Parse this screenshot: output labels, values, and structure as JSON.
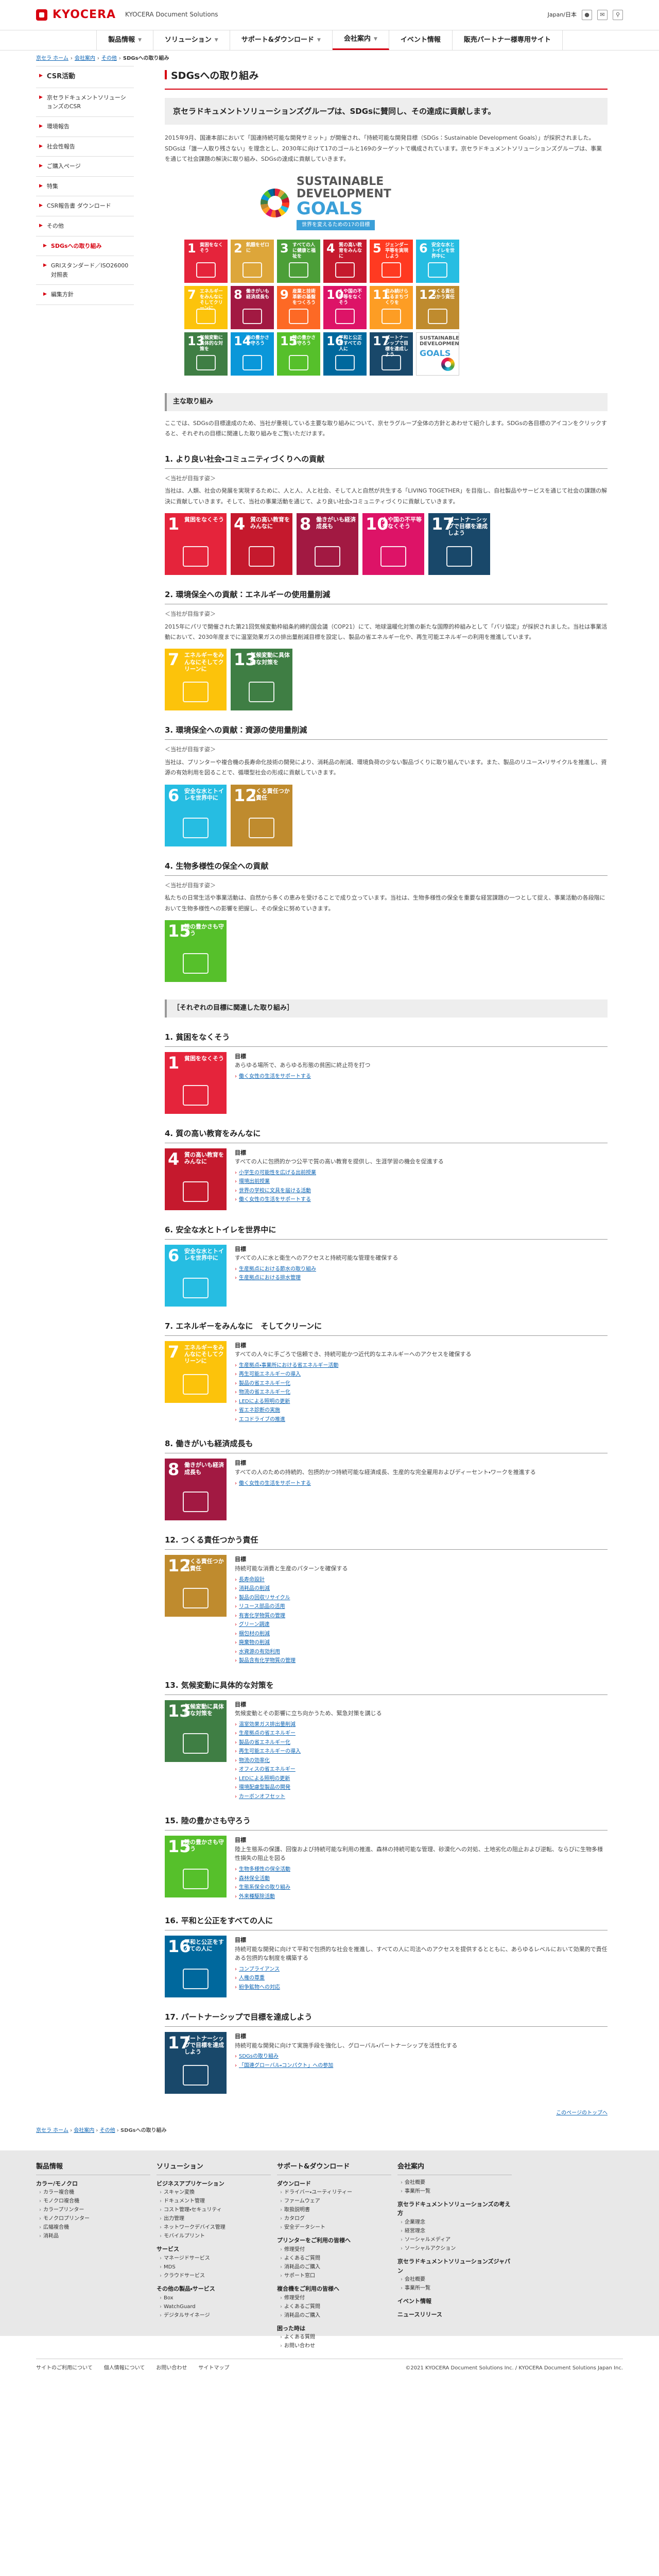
{
  "header": {
    "logo_text": "KYOCERA",
    "logo_sub": "KYOCERA Document Solutions",
    "lang": "Japan/日本",
    "nav": [
      {
        "label": "製品情報"
      },
      {
        "label": "ソリューション"
      },
      {
        "label": "サポート&ダウンロード"
      },
      {
        "label": "会社案内"
      },
      {
        "label": "イベント情報"
      },
      {
        "label": "販売パートナー様専用サイト"
      }
    ]
  },
  "breadcrumb": {
    "items": [
      "京セラ ホーム",
      "会社案内",
      "その他"
    ],
    "current": "SDGsへの取り組み"
  },
  "sidebar": {
    "items": [
      {
        "label": "CSR活動",
        "type": "head"
      },
      {
        "label": "京セラドキュメントソリューションズのCSR",
        "type": "item"
      },
      {
        "label": "環境報告",
        "type": "item"
      },
      {
        "label": "社会性報告",
        "type": "item"
      },
      {
        "label": "ご購入ページ",
        "type": "item"
      },
      {
        "label": "特集",
        "type": "item"
      },
      {
        "label": "CSR報告書 ダウンロード",
        "type": "item"
      },
      {
        "label": "その他",
        "type": "item"
      },
      {
        "label": "SDGsへの取り組み",
        "type": "current"
      },
      {
        "label": "GRIスタンダード／ISO26000対照表",
        "type": "sub"
      },
      {
        "label": "編集方針",
        "type": "sub"
      }
    ]
  },
  "main": {
    "title": "SDGsへの取り組み",
    "lead": "京セラドキュメントソリューションズグループは、SDGsに賛同し、その達成に貢献します。",
    "intro": "2015年9月、国連本部において「国連持続可能な開発サミット」が開催され、「持続可能な開発目標（SDGs：Sustainable Development Goals）」が採択されました。SDGsは「誰一人取り残さない」を理念とし、2030年に向けて17のゴールと169のターゲットで構成されています。京セラドキュメントソリューションズグループは、事業を通じて社会課題の解決に取り組み、SDGsの達成に貢献していきます。",
    "logo": {
      "line1": "SUSTAINABLE",
      "line2": "DEVELOPMENT",
      "goals": "GOALS",
      "band": "世界を変えるための17の目標"
    },
    "section1_title": "主な取り組み",
    "section1_intro": "ここでは、SDGsの目標達成のため、当社が重視している主要な取り組みについて、京セラグループ全体の方針とあわせて紹介します。SDGsの各目標のアイコンをクリックすると、それぞれの目標に関連した取り組みをご覧いただけます。",
    "topics": [
      {
        "title": "1. より良い社会・コミュニティづくりへの貢献",
        "tag": "＜当社が目指す姿＞",
        "text": "当社は、人類、社会の発展を実現するために、人と人、人と社会、そして人と自然が共生する「LIVING TOGETHER」を目指し、自社製品やサービスを通じて社会の課題の解決に貢献していきます。そして、当社の事業活動を通じて、より良い社会・コミュニティづくりに貢献していきます。"
      },
      {
        "title": "2. 環境保全への貢献：エネルギーの使用量削減",
        "tag": "＜当社が目指す姿＞",
        "text": "2015年にパリで開催された第21回気候変動枠組条約締約国会議（COP21）にて、地球温暖化対策の新たな国際的枠組みとして「パリ協定」が採択されました。当社は事業活動において、2030年度までに温室効果ガスの排出量削減目標を設定し、製品の省エネルギー化や、再生可能エネルギーの利用を推進しています。"
      },
      {
        "title": "3. 環境保全への貢献：資源の使用量削減",
        "tag": "＜当社が目指す姿＞",
        "text": "当社は、プリンターや複合機の長寿命化技術の開発により、消耗品の削減、環境負荷の少ない製品づくりに取り組んでいます。また、製品のリユース・リサイクルを推進し、資源の有効利用を図ることで、循環型社会の形成に貢献していきます。"
      },
      {
        "title": "4. 生物多様性の保全への貢献",
        "tag": "＜当社が目指す姿＞",
        "text": "私たちの日常生活や事業活動は、自然から多くの恵みを受けることで成り立っています。当社は、生物多様性の保全を重要な経営課題の一つとして捉え、事業活動の各段階において生物多様性への影響を把握し、その保全に努めていきます。"
      }
    ],
    "section2_title": "［それぞれの目標に関連した取り組み］",
    "goals": [
      {
        "title": "1. 貧困をなくそう",
        "goal_label": "目標",
        "goal_desc": "あらゆる場所で、あらゆる形態の貧困に終止符を打つ",
        "links": [
          "働く女性の生活をサポートする"
        ]
      },
      {
        "title": "4. 質の高い教育をみんなに",
        "goal_label": "目標",
        "goal_desc": "すべての人に包摂的かつ公平で質の高い教育を提供し、生涯学習の機会を促進する",
        "links": [
          "小学生の可能性を広げる出前授業",
          "環境出前授業",
          "世界の学校に文具を届ける活動",
          "働く女性の生活をサポートする"
        ]
      },
      {
        "title": "6. 安全な水とトイレを世界中に",
        "goal_label": "目標",
        "goal_desc": "すべての人に水と衛生へのアクセスと持続可能な管理を確保する",
        "links": [
          "生産拠点における節水の取り組み",
          "生産拠点における排水管理"
        ]
      },
      {
        "title": "7. エネルギーをみんなに　そしてクリーンに",
        "goal_label": "目標",
        "goal_desc": "すべての人々に手ごろで信頼でき、持続可能かつ近代的なエネルギーへのアクセスを確保する",
        "links": [
          "生産拠点・事業所における省エネルギー活動",
          "再生可能エネルギーの導入",
          "製品の省エネルギー化",
          "物流の省エネルギー化",
          "LEDによる照明の更新",
          "省エネ診断の実施",
          "エコドライブの推進"
        ]
      },
      {
        "title": "8. 働きがいも経済成長も",
        "goal_label": "目標",
        "goal_desc": "すべての人のための持続的、包摂的かつ持続可能な経済成長、生産的な完全雇用およびディーセント・ワークを推進する",
        "links": [
          "働く女性の生活をサポートする"
        ]
      },
      {
        "title": "12. つくる責任つかう責任",
        "goal_label": "目標",
        "goal_desc": "持続可能な消費と生産のパターンを確保する",
        "links": [
          "長寿命設計",
          "消耗品の削減",
          "製品の回収リサイクル",
          "リユース部品の活用",
          "有害化学物質の管理",
          "グリーン調達",
          "梱包材の削減",
          "廃棄物の削減",
          "水資源の有効利用",
          "製品含有化学物質の管理"
        ]
      },
      {
        "title": "13. 気候変動に具体的な対策を",
        "goal_label": "目標",
        "goal_desc": "気候変動とその影響に立ち向かうため、緊急対策を講じる",
        "links": [
          "温室効果ガス排出量削減",
          "生産拠点の省エネルギー",
          "製品の省エネルギー化",
          "再生可能エネルギーの導入",
          "物流の効率化",
          "オフィスの省エネルギー",
          "LEDによる照明の更新",
          "環境配慮型製品の開発",
          "カーボンオフセット"
        ]
      },
      {
        "title": "15. 陸の豊かさも守ろう",
        "goal_label": "目標",
        "goal_desc": "陸上生態系の保護、回復および持続可能な利用の推進、森林の持続可能な管理、砂漠化への対処、土地劣化の阻止および逆転、ならびに生物多様性損失の阻止を図る",
        "links": [
          "生物多様性の保全活動",
          "森林保全活動",
          "生態系保全の取り組み",
          "外来種駆除活動"
        ]
      },
      {
        "title": "16. 平和と公正をすべての人に",
        "goal_label": "目標",
        "goal_desc": "持続可能な開発に向けて平和で包摂的な社会を推進し、すべての人に司法へのアクセスを提供するとともに、あらゆるレベルにおいて効果的で責任ある包摂的な制度を構築する",
        "links": [
          "コンプライアンス",
          "人権の尊重",
          "紛争鉱物への対応"
        ]
      },
      {
        "title": "17. パートナーシップで目標を達成しよう",
        "goal_label": "目標",
        "goal_desc": "持続可能な開発に向けて実施手段を強化し、グローバル・パートナーシップを活性化する",
        "links": [
          "SDGsの取り組み",
          "「国連グローバル・コンパクト」への参加"
        ]
      }
    ],
    "pagetop": "このページのトップへ"
  },
  "tiles": [
    {
      "n": "1",
      "label": "貧困をなくそう",
      "color": "#e5243b"
    },
    {
      "n": "2",
      "label": "飢餓をゼロに",
      "color": "#dda63a"
    },
    {
      "n": "3",
      "label": "すべての人に健康と福祉を",
      "color": "#4c9f38"
    },
    {
      "n": "4",
      "label": "質の高い教育をみんなに",
      "color": "#c5192d"
    },
    {
      "n": "5",
      "label": "ジェンダー平等を実現しよう",
      "color": "#ff3a21"
    },
    {
      "n": "6",
      "label": "安全な水とトイレを世界中に",
      "color": "#26bde2"
    },
    {
      "n": "7",
      "label": "エネルギーをみんなにそしてクリーンに",
      "color": "#fcc30b"
    },
    {
      "n": "8",
      "label": "働きがいも経済成長も",
      "color": "#a21942"
    },
    {
      "n": "9",
      "label": "産業と技術革新の基盤をつくろう",
      "color": "#fd6925"
    },
    {
      "n": "10",
      "label": "人や国の不平等をなくそう",
      "color": "#dd1367"
    },
    {
      "n": "11",
      "label": "住み続けられるまちづくりを",
      "color": "#fd9d24"
    },
    {
      "n": "12",
      "label": "つくる責任つかう責任",
      "color": "#bf8b2e"
    },
    {
      "n": "13",
      "label": "気候変動に具体的な対策を",
      "color": "#3f7e44"
    },
    {
      "n": "14",
      "label": "海の豊かさを守ろう",
      "color": "#0a97d9"
    },
    {
      "n": "15",
      "label": "陸の豊かさも守ろう",
      "color": "#56c02b"
    },
    {
      "n": "16",
      "label": "平和と公正をすべての人に",
      "color": "#00689d"
    },
    {
      "n": "17",
      "label": "パートナーシップで目標を達成しよう",
      "color": "#19486a"
    }
  ],
  "footer": {
    "breadcrumb": [
      "京セラ ホーム",
      "会社案内",
      "その他",
      "SDGsへの取り組み"
    ],
    "columns": [
      {
        "head": "製品情報",
        "sections": [
          {
            "title": "カラー/モノクロ",
            "items": [
              "カラー複合機",
              "モノクロ複合機",
              "カラープリンター",
              "モノクロプリンター",
              "広幅複合機",
              "消耗品"
            ]
          }
        ]
      },
      {
        "head": "ソリューション",
        "sections": [
          {
            "title": "ビジネスアプリケーション",
            "items": [
              "スキャン変換",
              "ドキュメント管理",
              "コスト管理・セキュリティ",
              "出力管理",
              "ネットワークデバイス管理",
              "モバイルプリント"
            ]
          },
          {
            "title": "サービス",
            "items": [
              "マネージドサービス",
              "MDS",
              "クラウドサービス"
            ]
          },
          {
            "title": "その他の製品・サービス",
            "items": [
              "Box",
              "WatchGuard",
              "デジタルサイネージ"
            ]
          }
        ]
      },
      {
        "head": "サポート&ダウンロード",
        "sections": [
          {
            "title": "ダウンロード",
            "items": [
              "ドライバー・ユーティリティー",
              "ファームウェア",
              "取扱説明書",
              "カタログ",
              "安全データシート"
            ]
          },
          {
            "title": "プリンターをご利用の皆様へ",
            "items": [
              "修理受付",
              "よくあるご質問",
              "消耗品のご購入",
              "サポート窓口"
            ]
          },
          {
            "title": "複合機をご利用の皆様へ",
            "items": [
              "修理受付",
              "よくあるご質問",
              "消耗品のご購入"
            ]
          },
          {
            "title": "困った時は",
            "items": [
              "よくある質問",
              "お問い合わせ"
            ]
          }
        ]
      },
      {
        "head": "会社案内",
        "sections": [
          {
            "title": "",
            "items": [
              "会社概要",
              "事業所一覧"
            ]
          },
          {
            "title": "京セラドキュメントソリューションズの考え方",
            "items": [
              "企業理念",
              "経営理念",
              "ソーシャルメディア",
              "ソーシャルアクション"
            ]
          },
          {
            "title": "京セラドキュメントソリューションズジャパン",
            "items": [
              "会社概要",
              "事業所一覧"
            ]
          },
          {
            "title": "イベント情報",
            "items": []
          },
          {
            "title": "ニュースリリース",
            "items": []
          }
        ]
      }
    ],
    "links": [
      "サイトのご利用について",
      "個人情報について",
      "お問い合わせ",
      "サイトマップ"
    ],
    "copyright": "©2021 KYOCERA Document Solutions Inc. / KYOCERA Document Solutions Japan Inc."
  }
}
